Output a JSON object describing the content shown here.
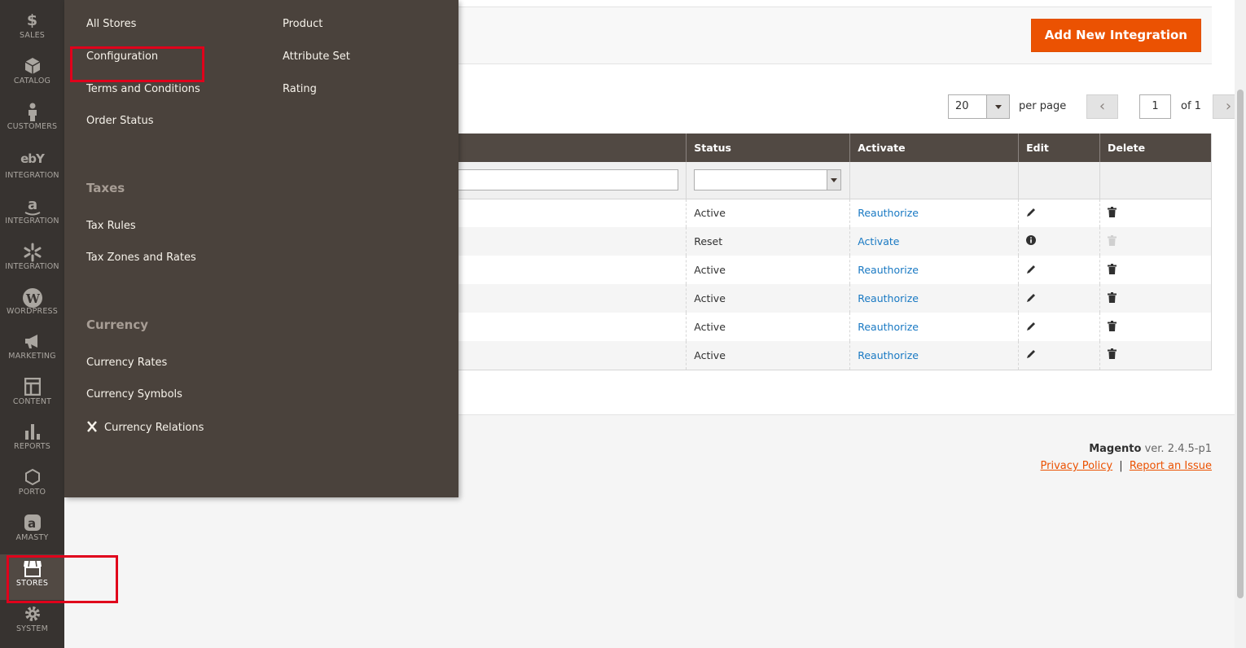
{
  "sidebar": {
    "items": [
      {
        "label": "SALES",
        "icon": "dollar-icon"
      },
      {
        "label": "CATALOG",
        "icon": "cube-icon"
      },
      {
        "label": "CUSTOMERS",
        "icon": "person-icon"
      },
      {
        "label": "INTEGRATION",
        "icon": "ebay-icon"
      },
      {
        "label": "INTEGRATION",
        "icon": "amazon-icon"
      },
      {
        "label": "INTEGRATION",
        "icon": "walmart-spark-icon"
      },
      {
        "label": "WORDPRESS",
        "icon": "wordpress-icon"
      },
      {
        "label": "MARKETING",
        "icon": "megaphone-icon"
      },
      {
        "label": "CONTENT",
        "icon": "layout-icon"
      },
      {
        "label": "REPORTS",
        "icon": "bar-chart-icon"
      },
      {
        "label": "PORTO",
        "icon": "hexagon-icon"
      },
      {
        "label": "AMASTY",
        "icon": "amasty-icon"
      },
      {
        "label": "STORES",
        "icon": "store-icon"
      },
      {
        "label": "SYSTEM",
        "icon": "gear-icon"
      }
    ],
    "active": "STORES"
  },
  "flyout": {
    "col1": {
      "items": [
        "All Stores",
        "Configuration",
        "Terms and Conditions",
        "Order Status"
      ],
      "taxes_heading": "Taxes",
      "taxes": [
        "Tax Rules",
        "Tax Zones and Rates"
      ],
      "currency_heading": "Currency",
      "currency": [
        "Currency Rates",
        "Currency Symbols",
        "Currency Relations"
      ]
    },
    "col2": {
      "items": [
        "Product",
        "Attribute Set",
        "Rating"
      ]
    }
  },
  "actions": {
    "add_label": "Add New Integration"
  },
  "pager": {
    "per_page_value": "20",
    "per_page_label": "per page",
    "page": "1",
    "of_label": "of 1",
    "prev": "‹",
    "next": "›"
  },
  "grid": {
    "headers": {
      "status": "Status",
      "activate": "Activate",
      "edit": "Edit",
      "delete": "Delete"
    },
    "rows": [
      {
        "status": "Active",
        "action": "Reauthorize"
      },
      {
        "status": "Reset",
        "action": "Activate"
      },
      {
        "status": "Active",
        "action": "Reauthorize"
      },
      {
        "status": "Active",
        "action": "Reauthorize"
      },
      {
        "status": "Active",
        "action": "Reauthorize"
      },
      {
        "status": "Active",
        "action": "Reauthorize"
      }
    ]
  },
  "footer": {
    "brand": "Magento",
    "version": "ver. 2.4.5-p1",
    "privacy": "Privacy Policy",
    "separator": "|",
    "report": "Report an Issue"
  },
  "colors": {
    "accent": "#eb5202",
    "sidebar": "#373330",
    "flyout": "#4a423c",
    "link": "#1979c3",
    "highlight": "#e0001b"
  }
}
